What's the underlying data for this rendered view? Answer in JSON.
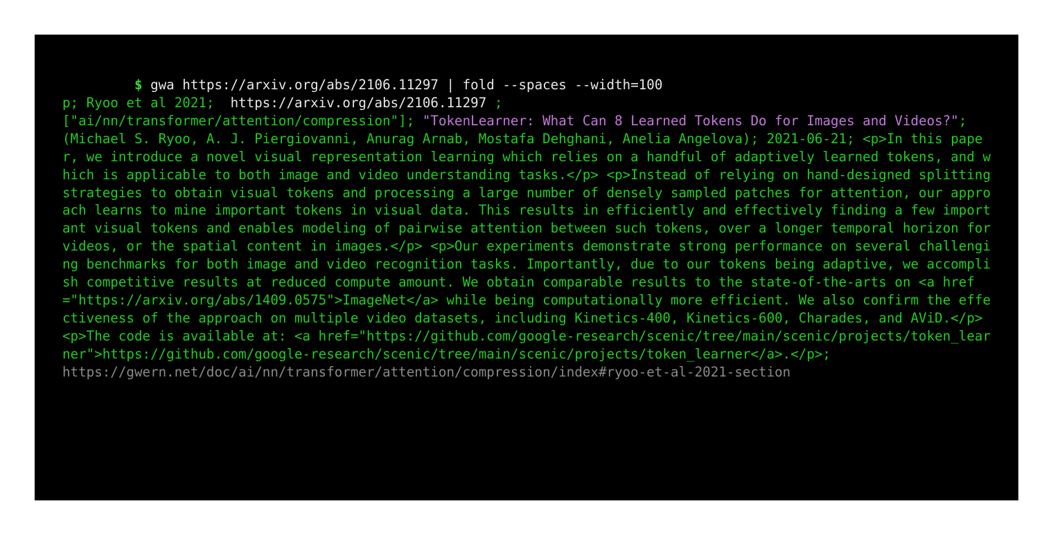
{
  "terminal": {
    "prompt_dollar": "$",
    "command": "gwa https://arxiv.org/abs/2106.11297 | fold --spaces --width=100",
    "line2_a": "p; Ryoo et al 2021;  ",
    "line2_b": "https://arxiv.org/abs/2106.11297",
    "line2_c": " ;",
    "tag_line": "[\"ai/nn/transformer/attention/compression\"]",
    "title_a": "\"TokenLearner: What Can 8 Learned Tokens Do for ",
    "title_b": "Images and Videos?\"",
    "authors_and_date": "  (Michael S. Ryoo, A. J. Piergiovanni, Anurag Arnab, Mostafa Dehghani, Anelia Angelova); 2021-06-21; ",
    "abstract": "<p>In this paper, we introduce a novel visual representation learning which relies on a handful of adaptively learned tokens, and which is applicable to both image and video understanding tasks.</p> <p>Instead of relying on hand-designed splitting strategies to obtain visual tokens and processing a large number of densely sampled patches for attention, our approach learns to mine important tokens in visual data. This results in efficiently and effectively finding a few important visual tokens and enables modeling of pairwise attention between such tokens, over a longer temporal horizon for videos, or the spatial content in images.</p> <p>Our experiments demonstrate strong performance on several challenging benchmarks for both image and video recognition tasks. Importantly, due to our tokens being adaptive, we accomplish competitive results at reduced compute amount. We obtain comparable results to the state-of-the-arts on <a href=\"https://arxiv.org/abs/1409.0575\">ImageNet</a> while being computationally more efficient. We also confirm the effectiveness of the approach on multiple video datasets, including Kinetics-400, Kinetics-600, Charades, and AViD.</p> <p>The code is available at: <a href=\"https://github.com/google-research/scenic/tree/main/scenic/projects/token_learner\">https://github.com/google-research/scenic/tree/main/scenic/projects/token_learner</a>.</p>;",
    "footer_url": "https://gwern.net/doc/ai/nn/transformer/attention/compression/index#ryoo-et-al-2021-section"
  }
}
